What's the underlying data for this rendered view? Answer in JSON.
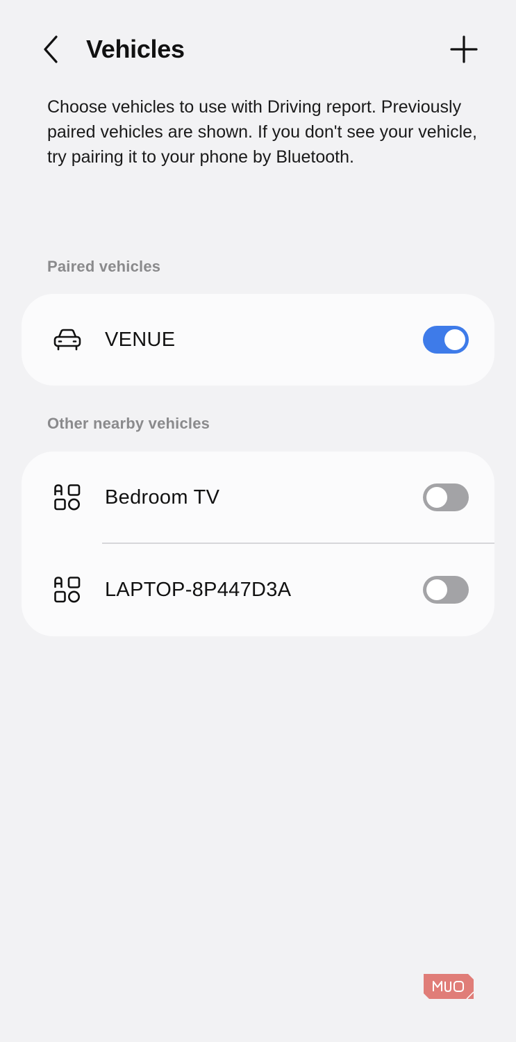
{
  "header": {
    "title": "Vehicles",
    "back_icon": "chevron-left-icon",
    "add_icon": "plus-icon"
  },
  "description": "Choose vehicles to use with Driving report. Previously paired vehicles are shown. If you don't see your vehicle, try pairing it to your phone by Bluetooth.",
  "paired": {
    "label": "Paired vehicles",
    "items": [
      {
        "name": "VENUE",
        "icon": "car-icon",
        "enabled": true
      }
    ]
  },
  "nearby": {
    "label": "Other nearby vehicles",
    "items": [
      {
        "name": "Bedroom TV",
        "icon": "devices-icon",
        "enabled": false
      },
      {
        "name": "LAPTOP-8P447D3A",
        "icon": "devices-icon",
        "enabled": false
      }
    ]
  },
  "watermark": {
    "text": "MUO"
  },
  "colors": {
    "background": "#f2f2f4",
    "card": "#fbfbfc",
    "toggle_on": "#3e7be9",
    "toggle_off": "#a3a3a6",
    "section_label": "#8a8a8c",
    "watermark": "#e07d78"
  }
}
